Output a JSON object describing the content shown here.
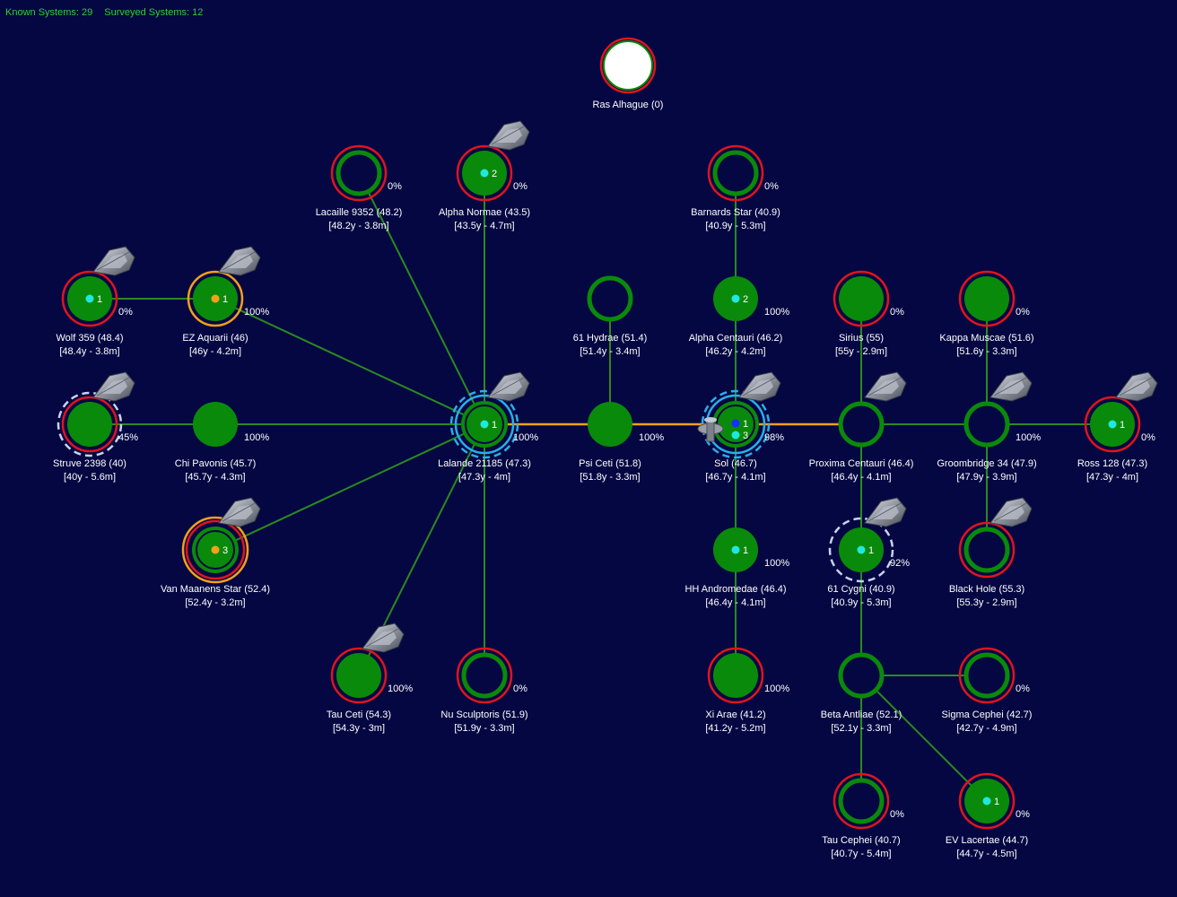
{
  "hud": {
    "known_label": "Known Systems: 29",
    "surveyed_label": "Surveyed Systems: 12"
  },
  "colors": {
    "background": "#040742",
    "link": "#2a8a1f",
    "link_highlight": "#f3a01a",
    "system_fill": "#0a8a0a",
    "ring_red": "#e0141e",
    "ring_orange": "#f3a01a",
    "ring_cyan": "#2aaee8",
    "ring_dashed": "#c8d4f2",
    "pop_cyan": "#20e8e0",
    "pop_orange": "#f3a01a",
    "pop_blue": "#1530ff",
    "text": "#ffffff",
    "hud_text": "#2fd12f"
  },
  "systems": [
    {
      "id": "ras-alhague",
      "name": "Ras Alhague  (0)",
      "sub": "",
      "pct": "",
      "style": "white-star",
      "rings": [
        "red"
      ],
      "pops": [],
      "fleet": false
    },
    {
      "id": "lacaille-9352",
      "name": "Lacaille 9352  (48.2)",
      "sub": "[48.2y - 3.8m]",
      "pct": "0%",
      "style": "hollow",
      "rings": [
        "red"
      ],
      "pops": [],
      "fleet": false
    },
    {
      "id": "alpha-normae",
      "name": "Alpha Normae  (43.5)",
      "sub": "[43.5y - 4.7m]",
      "pct": "0%",
      "style": "solid",
      "rings": [
        "red"
      ],
      "pops": [
        {
          "color": "cyan",
          "count": "2"
        }
      ],
      "fleet": true
    },
    {
      "id": "barnards-star",
      "name": "Barnards Star  (40.9)",
      "sub": "[40.9y - 5.3m]",
      "pct": "0%",
      "style": "hollow",
      "rings": [
        "red"
      ],
      "pops": [],
      "fleet": false
    },
    {
      "id": "wolf-359",
      "name": "Wolf 359  (48.4)",
      "sub": "[48.4y - 3.8m]",
      "pct": "0%",
      "style": "solid",
      "rings": [
        "red"
      ],
      "pops": [
        {
          "color": "cyan",
          "count": "1"
        }
      ],
      "fleet": true
    },
    {
      "id": "ez-aquarii",
      "name": "EZ Aquarii  (46)",
      "sub": "[46y - 4.2m]",
      "pct": "100%",
      "style": "solid",
      "rings": [
        "orange"
      ],
      "pops": [
        {
          "color": "orange",
          "count": "1"
        }
      ],
      "fleet": true
    },
    {
      "id": "61-hydrae",
      "name": "61 Hydrae  (51.4)",
      "sub": "[51.4y - 3.4m]",
      "pct": "",
      "style": "hollow",
      "rings": [],
      "pops": [],
      "fleet": false
    },
    {
      "id": "alpha-centauri",
      "name": "Alpha Centauri  (46.2)",
      "sub": "[46.2y - 4.2m]",
      "pct": "100%",
      "style": "solid",
      "rings": [],
      "pops": [
        {
          "color": "cyan",
          "count": "2"
        }
      ],
      "fleet": false
    },
    {
      "id": "sirius",
      "name": "Sirius  (55)",
      "sub": "[55y - 2.9m]",
      "pct": "0%",
      "style": "solid",
      "rings": [
        "red"
      ],
      "pops": [],
      "fleet": false
    },
    {
      "id": "kappa-muscae",
      "name": "Kappa Muscae  (51.6)",
      "sub": "[51.6y - 3.3m]",
      "pct": "0%",
      "style": "solid",
      "rings": [
        "red"
      ],
      "pops": [],
      "fleet": false
    },
    {
      "id": "struve-2398",
      "name": "Struve 2398  (40)",
      "sub": "[40y - 5.6m]",
      "pct": "45%",
      "style": "solid",
      "rings": [
        "red",
        "dashed"
      ],
      "pops": [],
      "fleet": true
    },
    {
      "id": "chi-pavonis",
      "name": "Chi Pavonis  (45.7)",
      "sub": "[45.7y - 4.3m]",
      "pct": "100%",
      "style": "solid",
      "rings": [],
      "pops": [],
      "fleet": false
    },
    {
      "id": "lalande-21185",
      "name": "Lalande 21185  (47.3)",
      "sub": "[47.3y - 4m]",
      "pct": "100%",
      "style": "solid-ring",
      "rings": [
        "cyan",
        "dashed-cyan"
      ],
      "pops": [
        {
          "color": "cyan",
          "count": "1"
        }
      ],
      "fleet": true
    },
    {
      "id": "psi-ceti",
      "name": "Psi Ceti  (51.8)",
      "sub": "[51.8y - 3.3m]",
      "pct": "100%",
      "style": "solid",
      "rings": [],
      "pops": [],
      "fleet": false
    },
    {
      "id": "sol",
      "name": "Sol  (46.7)",
      "sub": "[46.7y - 4.1m]",
      "pct": "98%",
      "style": "solid-ring",
      "rings": [
        "cyan",
        "dashed-cyan"
      ],
      "pops": [
        {
          "color": "blue",
          "count": "1"
        },
        {
          "color": "cyan",
          "count": "3"
        }
      ],
      "fleet": true,
      "station": true
    },
    {
      "id": "proxima-centauri",
      "name": "Proxima Centauri  (46.4)",
      "sub": "[46.4y - 4.1m]",
      "pct": "",
      "style": "hollow",
      "rings": [],
      "pops": [],
      "fleet": true
    },
    {
      "id": "groombridge-34",
      "name": "Groombridge 34  (47.9)",
      "sub": "[47.9y - 3.9m]",
      "pct": "100%",
      "style": "hollow",
      "rings": [],
      "pops": [],
      "fleet": true
    },
    {
      "id": "ross-128",
      "name": "Ross 128  (47.3)",
      "sub": "[47.3y - 4m]",
      "pct": "0%",
      "style": "solid",
      "rings": [
        "red"
      ],
      "pops": [
        {
          "color": "cyan",
          "count": "1"
        }
      ],
      "fleet": true
    },
    {
      "id": "van-maanens-star",
      "name": "Van Maanens Star  (52.4)",
      "sub": "[52.4y - 3.2m]",
      "pct": "",
      "style": "solid-ring",
      "rings": [
        "orange",
        "red"
      ],
      "pops": [
        {
          "color": "orange",
          "count": "3"
        }
      ],
      "fleet": true
    },
    {
      "id": "hh-andromedae",
      "name": "HH Andromedae  (46.4)",
      "sub": "[46.4y - 4.1m]",
      "pct": "100%",
      "style": "solid",
      "rings": [],
      "pops": [
        {
          "color": "cyan",
          "count": "1"
        }
      ],
      "fleet": false
    },
    {
      "id": "61-cygni",
      "name": "61 Cygni  (40.9)",
      "sub": "[40.9y - 5.3m]",
      "pct": "92%",
      "style": "solid",
      "rings": [
        "dashed"
      ],
      "pops": [
        {
          "color": "cyan",
          "count": "1"
        }
      ],
      "fleet": true
    },
    {
      "id": "black-hole",
      "name": "Black Hole  (55.3)",
      "sub": "[55.3y - 2.9m]",
      "pct": "",
      "style": "hollow",
      "rings": [
        "red"
      ],
      "pops": [],
      "fleet": true
    },
    {
      "id": "tau-ceti",
      "name": "Tau Ceti  (54.3)",
      "sub": "[54.3y - 3m]",
      "pct": "100%",
      "style": "solid",
      "rings": [
        "red"
      ],
      "pops": [],
      "fleet": true
    },
    {
      "id": "nu-sculptoris",
      "name": "Nu Sculptoris  (51.9)",
      "sub": "[51.9y - 3.3m]",
      "pct": "0%",
      "style": "hollow",
      "rings": [
        "red"
      ],
      "pops": [],
      "fleet": false
    },
    {
      "id": "xi-arae",
      "name": "Xi Arae  (41.2)",
      "sub": "[41.2y - 5.2m]",
      "pct": "100%",
      "style": "solid",
      "rings": [
        "red"
      ],
      "pops": [],
      "fleet": false
    },
    {
      "id": "beta-antliae",
      "name": "Beta Antliae  (52.1)",
      "sub": "[52.1y - 3.3m]",
      "pct": "",
      "style": "hollow",
      "rings": [],
      "pops": [],
      "fleet": false
    },
    {
      "id": "sigma-cephei",
      "name": "Sigma Cephei  (42.7)",
      "sub": "[42.7y - 4.9m]",
      "pct": "0%",
      "style": "hollow",
      "rings": [
        "red"
      ],
      "pops": [],
      "fleet": false
    },
    {
      "id": "tau-cephei",
      "name": "Tau Cephei  (40.7)",
      "sub": "[40.7y - 5.4m]",
      "pct": "0%",
      "style": "hollow",
      "rings": [
        "red"
      ],
      "pops": [],
      "fleet": false
    },
    {
      "id": "ev-lacertae",
      "name": "EV Lacertae  (44.7)",
      "sub": "[44.7y - 4.5m]",
      "pct": "0%",
      "style": "solid",
      "rings": [
        "red"
      ],
      "pops": [
        {
          "color": "cyan",
          "count": "1"
        }
      ],
      "fleet": false
    }
  ],
  "links": [
    {
      "a": "wolf-359",
      "b": "ez-aquarii",
      "kind": "normal"
    },
    {
      "a": "ez-aquarii",
      "b": "lalande-21185",
      "kind": "normal"
    },
    {
      "a": "lacaille-9352",
      "b": "lalande-21185",
      "kind": "normal"
    },
    {
      "a": "alpha-normae",
      "b": "lalande-21185",
      "kind": "normal"
    },
    {
      "a": "struve-2398",
      "b": "lalande-21185",
      "kind": "normal"
    },
    {
      "a": "van-maanens-star",
      "b": "lalande-21185",
      "kind": "normal"
    },
    {
      "a": "tau-ceti",
      "b": "lalande-21185",
      "kind": "normal"
    },
    {
      "a": "nu-sculptoris",
      "b": "lalande-21185",
      "kind": "normal"
    },
    {
      "a": "lalande-21185",
      "b": "psi-ceti",
      "kind": "highlight"
    },
    {
      "a": "psi-ceti",
      "b": "sol",
      "kind": "highlight"
    },
    {
      "a": "61-hydrae",
      "b": "psi-ceti",
      "kind": "normal"
    },
    {
      "a": "sol",
      "b": "proxima-centauri",
      "kind": "highlight"
    },
    {
      "a": "barnards-star",
      "b": "alpha-centauri",
      "kind": "normal"
    },
    {
      "a": "alpha-centauri",
      "b": "sol",
      "kind": "normal"
    },
    {
      "a": "sol",
      "b": "hh-andromedae",
      "kind": "normal"
    },
    {
      "a": "hh-andromedae",
      "b": "xi-arae",
      "kind": "normal"
    },
    {
      "a": "proxima-centauri",
      "b": "sirius",
      "kind": "normal"
    },
    {
      "a": "proxima-centauri",
      "b": "groombridge-34",
      "kind": "normal"
    },
    {
      "a": "groombridge-34",
      "b": "ross-128",
      "kind": "normal"
    },
    {
      "a": "groombridge-34",
      "b": "kappa-muscae",
      "kind": "normal"
    },
    {
      "a": "groombridge-34",
      "b": "black-hole",
      "kind": "normal"
    },
    {
      "a": "proxima-centauri",
      "b": "61-cygni",
      "kind": "normal"
    },
    {
      "a": "61-cygni",
      "b": "beta-antliae",
      "kind": "normal"
    },
    {
      "a": "beta-antliae",
      "b": "sigma-cephei",
      "kind": "normal"
    },
    {
      "a": "beta-antliae",
      "b": "tau-cephei",
      "kind": "normal"
    },
    {
      "a": "beta-antliae",
      "b": "ev-lacertae",
      "kind": "normal"
    }
  ]
}
